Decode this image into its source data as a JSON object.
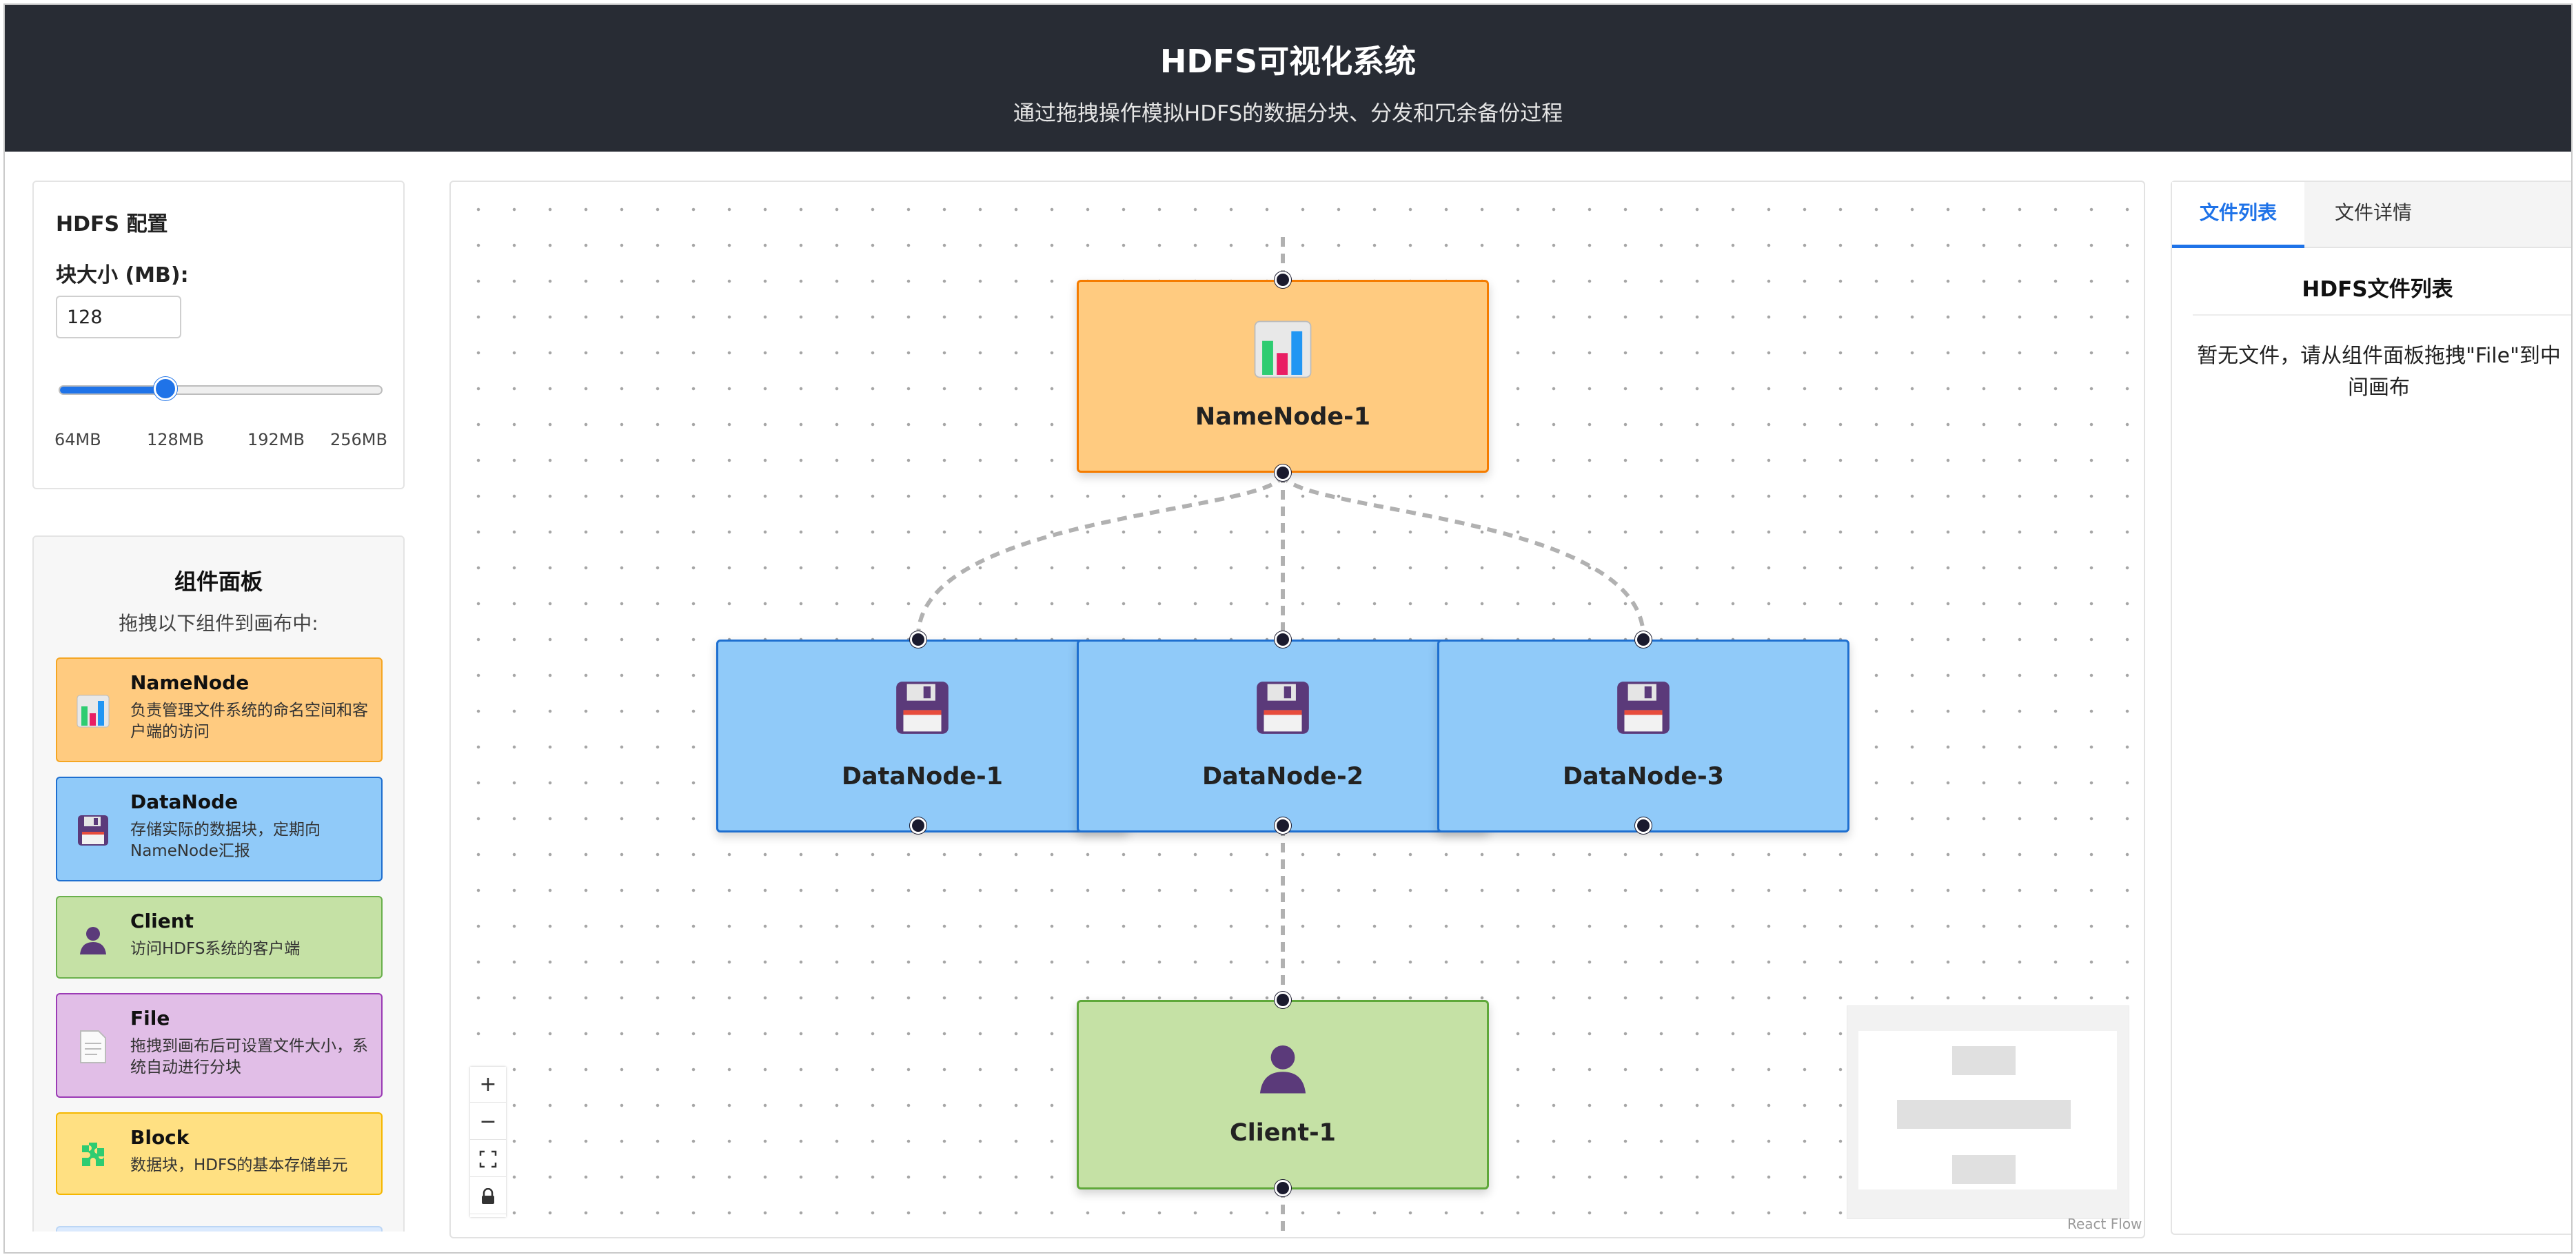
{
  "header": {
    "title": "HDFS可视化系统",
    "subtitle": "通过拖拽操作模拟HDFS的数据分块、分发和冗余备份过程"
  },
  "config": {
    "title": "HDFS 配置",
    "block_size_label": "块大小 (MB):",
    "block_size_value": "128",
    "slider_value_fraction": 0.33,
    "ticks": [
      "64MB",
      "128MB",
      "192MB",
      "256MB"
    ]
  },
  "palette": {
    "title": "组件面板",
    "subtitle": "拖拽以下组件到画布中:",
    "items": [
      {
        "name": "NameNode",
        "desc": "负责管理文件系统的命名空间和客户端的访问",
        "icon": "bar-chart-icon",
        "bg": "#ffcb80",
        "border": "#f5a623"
      },
      {
        "name": "DataNode",
        "desc": "存储实际的数据块，定期向NameNode汇报",
        "icon": "floppy-disk-icon",
        "bg": "#90caf9",
        "border": "#1e6fd0"
      },
      {
        "name": "Client",
        "desc": "访问HDFS系统的客户端",
        "icon": "user-icon",
        "bg": "#c5e1a5",
        "border": "#6ab04c"
      },
      {
        "name": "File",
        "desc": "拖拽到画布后可设置文件大小，系统自动进行分块",
        "icon": "document-icon",
        "bg": "#e1bee7",
        "border": "#9b3bb5"
      },
      {
        "name": "Block",
        "desc": "数据块，HDFS的基本存储单元",
        "icon": "puzzle-icon",
        "bg": "#ffe082",
        "border": "#f5b700"
      }
    ]
  },
  "canvas": {
    "nodes": [
      {
        "id": "namenode-1",
        "label": "NameNode-1",
        "icon": "bar-chart-icon",
        "bg": "#ffcb80",
        "border": "#f57c00"
      },
      {
        "id": "datanode-1",
        "label": "DataNode-1",
        "icon": "floppy-disk-icon",
        "bg": "#90caf9",
        "border": "#1e6fd0"
      },
      {
        "id": "datanode-2",
        "label": "DataNode-2",
        "icon": "floppy-disk-icon",
        "bg": "#90caf9",
        "border": "#1e6fd0"
      },
      {
        "id": "datanode-3",
        "label": "DataNode-3",
        "icon": "floppy-disk-icon",
        "bg": "#90caf9",
        "border": "#1e6fd0"
      },
      {
        "id": "client-1",
        "label": "Client-1",
        "icon": "user-icon",
        "bg": "#c5e1a5",
        "border": "#5fa83a"
      }
    ],
    "controls": [
      "+",
      "−",
      "⛶",
      "🔒"
    ],
    "attribution": "React Flow"
  },
  "right_panel": {
    "tabs": [
      {
        "label": "文件列表",
        "active": true
      },
      {
        "label": "文件详情",
        "active": false
      }
    ],
    "title": "HDFS文件列表",
    "empty_text": "暂无文件，请从组件面板拖拽\"File\"到中间画布"
  }
}
